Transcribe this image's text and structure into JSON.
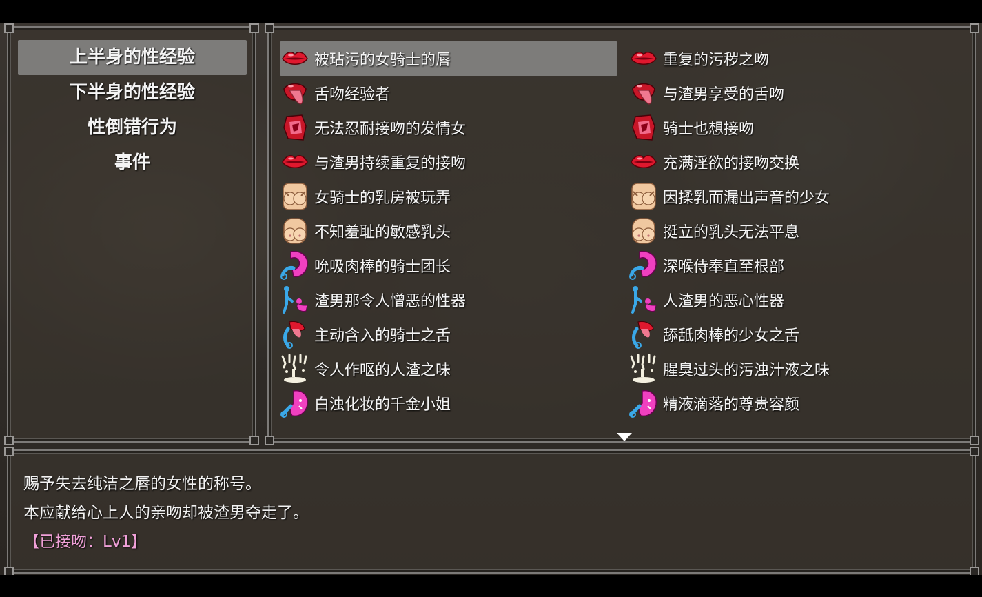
{
  "categories": [
    {
      "label": "上半身的性经验",
      "selected": true
    },
    {
      "label": "下半身的性经验",
      "selected": false
    },
    {
      "label": "性倒错行为",
      "selected": false
    },
    {
      "label": "事件",
      "selected": false
    }
  ],
  "skills": [
    {
      "label": "被玷污的女骑士的唇",
      "icon": "lips-icon",
      "selected": true
    },
    {
      "label": "重复的污秽之吻",
      "icon": "lips-icon"
    },
    {
      "label": "舌吻经验者",
      "icon": "tongue-icon"
    },
    {
      "label": "与渣男享受的舌吻",
      "icon": "tongue-icon"
    },
    {
      "label": "无法忍耐接吻的发情女",
      "icon": "kiss-mouth-icon"
    },
    {
      "label": "骑士也想接吻",
      "icon": "kiss-mouth-icon"
    },
    {
      "label": "与渣男持续重复的接吻",
      "icon": "lips-icon"
    },
    {
      "label": "充满淫欲的接吻交换",
      "icon": "lips-icon"
    },
    {
      "label": "女骑士的乳房被玩弄",
      "icon": "breast-hands-icon"
    },
    {
      "label": "因揉乳而漏出声音的少女",
      "icon": "breast-hands-icon"
    },
    {
      "label": "不知羞耻的敏感乳头",
      "icon": "breast-icon"
    },
    {
      "label": "挺立的乳头无法平息",
      "icon": "breast-icon"
    },
    {
      "label": "吮吸肉棒的骑士团长",
      "icon": "oral-pink-icon"
    },
    {
      "label": "深喉侍奉直至根部",
      "icon": "oral-pink-icon"
    },
    {
      "label": "渣男那令人憎恶的性器",
      "icon": "kneeling-figure-icon"
    },
    {
      "label": "人渣男的恶心性器",
      "icon": "kneeling-figure-icon"
    },
    {
      "label": "主动含入的骑士之舌",
      "icon": "tongue-blue-icon"
    },
    {
      "label": "舔舐肉棒的少女之舌",
      "icon": "tongue-blue-icon"
    },
    {
      "label": "令人作呕的人渣之味",
      "icon": "splash-icon"
    },
    {
      "label": "腥臭过头的污浊汁液之味",
      "icon": "splash-icon"
    },
    {
      "label": "白浊化妆的千金小姐",
      "icon": "face-pink-icon"
    },
    {
      "label": "精液滴落的尊贵容颜",
      "icon": "face-pink-icon"
    }
  ],
  "description": {
    "line1": "赐予失去纯洁之唇的女性的称号。",
    "line2": "本应献给心上人的亲吻却被渣男夺走了。",
    "status": "【已接吻：Lv1】"
  },
  "colors": {
    "selection": "#7d7c7a",
    "status_text": "#f0a0d8",
    "lips": "#e0182e",
    "pink": "#f040c0",
    "blue": "#3aa8e8",
    "skin": "#f0c8a0"
  }
}
